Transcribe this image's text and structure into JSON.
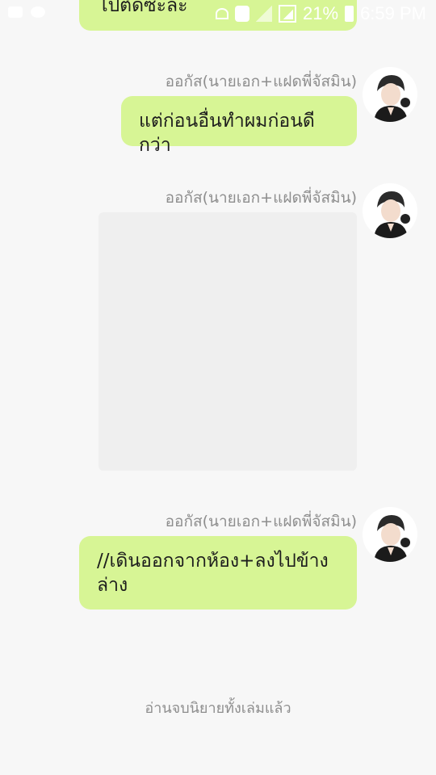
{
  "status_bar": {
    "battery_percent": "21%",
    "time": "6:59 PM",
    "icons": [
      "notification-icon",
      "wechat-icon",
      "wifi-calling-icon",
      "phone-icon",
      "signal-1-icon",
      "signal-2-icon",
      "battery-icon"
    ]
  },
  "chat": {
    "top_bubble_text": "ไปตัดซะละ",
    "messages": [
      {
        "sender": "ออกัส(นายเอก+แฝดพี่จัสมิน)",
        "text": "แต่ก่อนอื่นทำผมก่อนดีกว่า"
      },
      {
        "sender": "ออกัส(นายเอก+แฝดพี่จัสมิน)",
        "image": "image-message"
      },
      {
        "sender": "ออกัส(นายเอก+แฝดพี่จัสมิน)",
        "text": "//เดินออกจากห้อง+ลงไปข้าง\nล่าง"
      }
    ],
    "bubble_color": "#d7f595"
  },
  "footer": {
    "note": "อ่านจบนิยายทั้งเล่มแล้ว"
  }
}
